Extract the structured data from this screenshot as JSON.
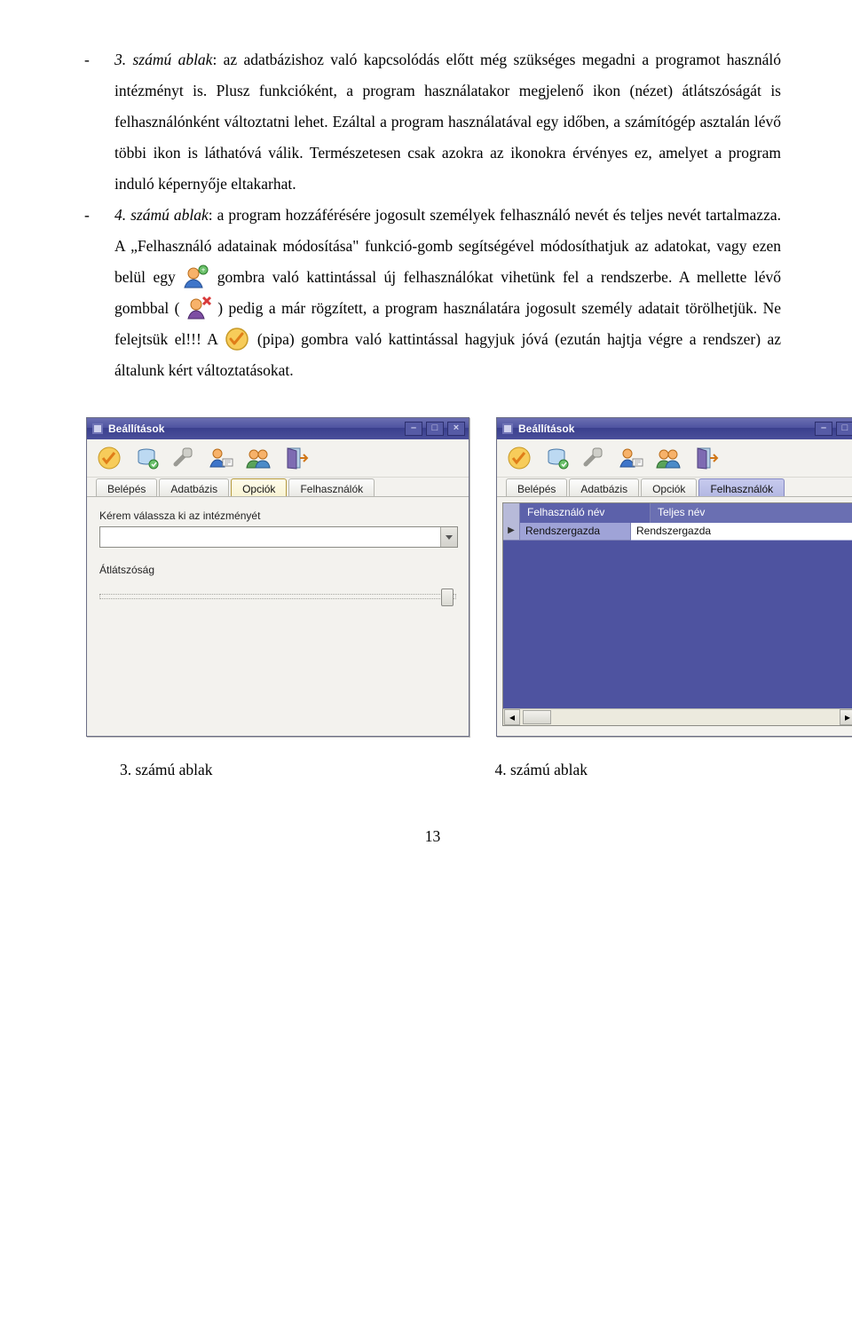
{
  "para1": {
    "dash": "-",
    "lead": "3. számú ablak",
    "rest": ": az adatbázishoz való kapcsolódás előtt még szükséges megadni a programot használó intézményt is. Plusz funkcióként, a program használatakor megjelenő ikon (nézet) átlátszóságát is felhasználónként változtatni lehet. Ezáltal a program használatával egy időben, a számítógép asztalán lévő többi ikon is láthatóvá válik. Természetesen csak azokra az ikonokra érvényes ez, amelyet a program induló képernyője eltakarhat."
  },
  "para2": {
    "dash": "-",
    "lead": "4. számú ablak",
    "s1": ": a program hozzáférésére jogosult személyek felhasználó nevét és teljes nevét tartalmazza. A „Felhasználó adatainak módosítása\" funkció-gomb segítségével módosíthatjuk az adatokat, vagy ezen belül egy ",
    "s2": " gombra való kattintással új felhasználókat vihetünk fel a rendszerbe. A mellette lévő gombbal ( ",
    "s3": " ) pedig a már rögzített, a program használatára jogosult személy adatait törölhetjük. Ne felejtsük el!!! A ",
    "s4": " (pipa) gombra való kattintással hagyjuk jóvá (ezután hajtja végre a rendszer) az általunk kért változtatásokat."
  },
  "windowTitle": "Beállítások",
  "minGlyph": "–",
  "maxGlyph": "□",
  "closeGlyph": "×",
  "tabs": {
    "t1": "Belépés",
    "t2": "Adatbázis",
    "t3": "Opciók",
    "t4": "Felhasználók"
  },
  "opts": {
    "institutionLabel": "Kérem válassza ki az intézményét",
    "transparencyLabel": "Átlátszóság"
  },
  "users": {
    "col1": "Felhasználó név",
    "col2": "Teljes név",
    "row1c1": "Rendszergazda",
    "row1c2": "Rendszergazda",
    "rowMarker": "▶"
  },
  "scroll": {
    "up": "▴",
    "down": "▾",
    "left": "◂",
    "right": "▸"
  },
  "captions": {
    "c1": "3. számú ablak",
    "c2": "4. számú ablak"
  },
  "pageNumber": "13"
}
